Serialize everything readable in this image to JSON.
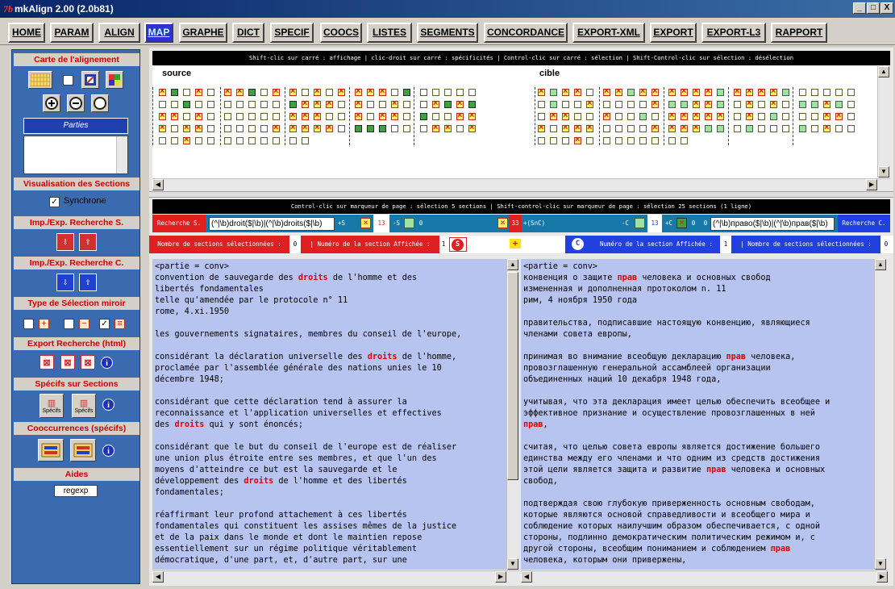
{
  "window": {
    "logo": "7b",
    "title": "mkAlign 2.00 (2.0b81)",
    "min": "_",
    "max": "□",
    "close": "X"
  },
  "menu": [
    "HOME",
    "PARAM",
    "ALIGN",
    "MAP",
    "GRAPHE",
    "DICT",
    "SPECIF",
    "COOCS",
    "LISTES",
    "SEGMENTS",
    "CONCORDANCE",
    "EXPORT-XML",
    "EXPORT",
    "EXPORT-L3",
    "RAPPORT"
  ],
  "active_menu": "MAP",
  "left": {
    "carte": "Carte de l'alignement",
    "parties": "Parties",
    "visu": "Visualisation des Sections",
    "synchrone": "Synchrone",
    "impS": "Imp./Exp. Recherche S.",
    "impC": "Imp./Exp. Recherche C.",
    "miroir": "Type de Sélection miroir",
    "export": "Export Recherche (html)",
    "specifs": "Spécifs sur Sections",
    "specifs_btn": "Spécifs",
    "coocs": "Cooccurrences (spécifs)",
    "aides": "Aides",
    "regexp": "regexp",
    "info": "i"
  },
  "map": {
    "hint": "Shift-clic sur carré : affichage | clic-droit sur carré : spécificités | Control-clic sur carré : sélection | Shift-Control-clic sur sélection : désélection",
    "source": "source",
    "cible": "cible"
  },
  "pagebar": "Control-clic sur marqueur de page : sélection 5 sections | Shift-control-clic sur marqueur de page : sélection 25 sections (1 ligne)",
  "search": {
    "label_s": "Recherche S.",
    "query_s": "(^|\\b)droit($|\\b)|(^|\\b)droits($|\\b)",
    "plus_s": "+S",
    "count_a": "13",
    "minus_s": "-S",
    "zero_a": "0",
    "count_b": "33",
    "sc": "+(S∩C)",
    "minus_c": "-C",
    "count_c": "13",
    "plus_c": "+C",
    "zero_c": "0",
    "zero_d": "0",
    "query_c": "(^|\\b)право($|\\b)|(^|\\b)прав($|\\b)",
    "label_c": "Recherche C."
  },
  "info": {
    "nb_left": "Nombre de sections sélectionnées :",
    "nb_left_val": "0",
    "num_left": "| Numéro de la section Affichée :",
    "num_left_val": "1",
    "s_badge": "S",
    "plus": "+",
    "c_badge": "C",
    "num_right": "Numéro de la section Affichée :",
    "num_right_val": "1",
    "nb_right": "| Nombre de sections sélectionnées :",
    "nb_right_val": "0"
  },
  "source_text": [
    [
      {
        "t": "<partie = conv>"
      }
    ],
    [
      {
        "t": "convention de sauvegarde des "
      },
      {
        "h": "droits"
      },
      {
        "t": " de l'homme et des"
      }
    ],
    [
      {
        "t": "libertés fondamentales"
      }
    ],
    [
      {
        "t": "telle qu'amendée par le protocole n° 11"
      }
    ],
    [
      {
        "t": "rome, 4.xi.1950"
      }
    ],
    [
      {
        "t": ""
      }
    ],
    [
      {
        "t": "les gouvernements signataires, membres du conseil de l'europe,"
      }
    ],
    [
      {
        "t": ""
      }
    ],
    [
      {
        "t": "considérant la déclaration universelle des "
      },
      {
        "h": "droits"
      },
      {
        "t": " de l'homme,"
      }
    ],
    [
      {
        "t": "proclamée par l'assemblée générale des nations unies le 10"
      }
    ],
    [
      {
        "t": "décembre 1948;"
      }
    ],
    [
      {
        "t": ""
      }
    ],
    [
      {
        "t": "considérant que cette déclaration tend à assurer la"
      }
    ],
    [
      {
        "t": "reconnaissance et l'application universelles et effectives"
      }
    ],
    [
      {
        "t": "des "
      },
      {
        "h": "droits"
      },
      {
        "t": " qui y sont énoncés;"
      }
    ],
    [
      {
        "t": ""
      }
    ],
    [
      {
        "t": "considérant que le but du conseil de l'europe est de réaliser"
      }
    ],
    [
      {
        "t": "une union plus étroite entre ses membres, et que l'un des"
      }
    ],
    [
      {
        "t": "moyens d'atteindre ce but est la sauvegarde et le"
      }
    ],
    [
      {
        "t": "développement des "
      },
      {
        "h": "droits"
      },
      {
        "t": " de l'homme et des libertés"
      }
    ],
    [
      {
        "t": "fondamentales;"
      }
    ],
    [
      {
        "t": ""
      }
    ],
    [
      {
        "t": "réaffirmant leur profond attachement à ces libertés"
      }
    ],
    [
      {
        "t": "fondamentales qui constituent les assises mêmes de la justice"
      }
    ],
    [
      {
        "t": "et de la paix dans le monde et dont le maintien repose"
      }
    ],
    [
      {
        "t": "essentiellement sur un régime politique véritablement"
      }
    ],
    [
      {
        "t": "démocratique, d'une part, et, d'autre part, sur une"
      }
    ]
  ],
  "target_text": [
    [
      {
        "t": "<partie = conv>"
      }
    ],
    [
      {
        "t": "конвенция о защите "
      },
      {
        "h": "прав"
      },
      {
        "t": " человека и основных свобод"
      }
    ],
    [
      {
        "t": "измененная и дополненная протоколом n. 11"
      }
    ],
    [
      {
        "t": "рим, 4 ноября 1950 года"
      }
    ],
    [
      {
        "t": ""
      }
    ],
    [
      {
        "t": "правительства, подписавшие настоящую конвенцию, являющиеся"
      }
    ],
    [
      {
        "t": "членами совета европы,"
      }
    ],
    [
      {
        "t": ""
      }
    ],
    [
      {
        "t": "принимая во внимание всеобщую декларацию "
      },
      {
        "h": "прав"
      },
      {
        "t": " человека,"
      }
    ],
    [
      {
        "t": "провозглашенную генеральной ассамблеей организации"
      }
    ],
    [
      {
        "t": "объединенных наций 10 декабря 1948 года,"
      }
    ],
    [
      {
        "t": ""
      }
    ],
    [
      {
        "t": "учитывая, что эта декларация имеет целью обеспечить всеобщее и"
      }
    ],
    [
      {
        "t": "эффективное признание и осуществление провозглашенных в ней"
      }
    ],
    [
      {
        "h": "прав"
      },
      {
        "t": ","
      }
    ],
    [
      {
        "t": ""
      }
    ],
    [
      {
        "t": "считая, что целью совета европы является достижение большего"
      }
    ],
    [
      {
        "t": "единства между его членами и что одним из средств достижения"
      }
    ],
    [
      {
        "t": "этой цели является защита и развитие "
      },
      {
        "h": "прав"
      },
      {
        "t": " человека и основных"
      }
    ],
    [
      {
        "t": "свобод,"
      }
    ],
    [
      {
        "t": ""
      }
    ],
    [
      {
        "t": "подтверждая свою глубокую приверженность основным свободам,"
      }
    ],
    [
      {
        "t": "которые являются основой справедливости и всеобщего мира и"
      }
    ],
    [
      {
        "t": "соблюдение которых наилучшим образом обеспечивается, с одной"
      }
    ],
    [
      {
        "t": "стороны, подлинно демократическим политическим режимом и, с"
      }
    ],
    [
      {
        "t": "другой стороны, всеобщим пониманием и соблюдением "
      },
      {
        "h": "прав"
      }
    ],
    [
      {
        "t": "человека, которым они привержены,"
      }
    ]
  ]
}
